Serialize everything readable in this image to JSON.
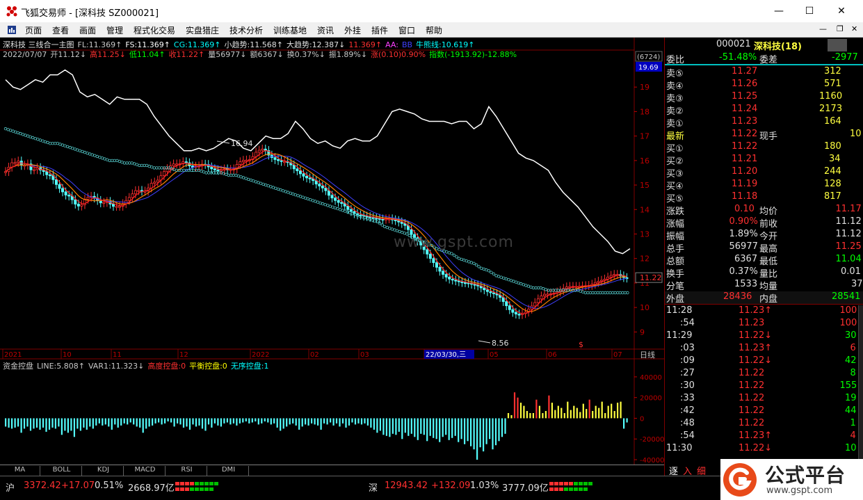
{
  "window": {
    "app_name": "飞狐交易师",
    "title": "飞狐交易师 - [深科技 SZ000021]",
    "minimize": "—",
    "maximize": "☐",
    "close": "✕"
  },
  "menu": [
    "页面",
    "查看",
    "画面",
    "管理",
    "程式化交易",
    "实盘猎庄",
    "技术分析",
    "训练基地",
    "资讯",
    "外挂",
    "插件",
    "窗口",
    "帮助"
  ],
  "mdi": [
    "—",
    "❐",
    "✕"
  ],
  "info_line1": [
    {
      "t": "深科技 三线合一主图",
      "c": "#e0e0e0"
    },
    {
      "t": "FL:11.369↑",
      "c": "#c8c8c8"
    },
    {
      "t": "FS:11.369↑",
      "c": "#ffffff"
    },
    {
      "t": "CG:11.369↑",
      "c": "#00ffff"
    },
    {
      "t": "小趋势:11.568↑",
      "c": "#e0e0e0"
    },
    {
      "t": "大趋势:12.387↓",
      "c": "#e0e0e0"
    },
    {
      "t": "11.369↑",
      "c": "#ff3030"
    },
    {
      "t": "AA:",
      "c": "#ff40ff"
    },
    {
      "t": "BB",
      "c": "#4040ff"
    },
    {
      "t": "牛熊线:10.619↑",
      "c": "#00ffff"
    }
  ],
  "info_line2": [
    {
      "t": "2022/07/07",
      "c": "#c8c8c8"
    },
    {
      "t": "开11.12↓",
      "c": "#c8c8c8"
    },
    {
      "t": "高11.25↓",
      "c": "#ff3030"
    },
    {
      "t": "低11.04↑",
      "c": "#00ff00"
    },
    {
      "t": "收11.22↑",
      "c": "#ff3030"
    },
    {
      "t": "量56977↓",
      "c": "#c8c8c8"
    },
    {
      "t": "额6367↓",
      "c": "#c8c8c8"
    },
    {
      "t": "换0.37%↓",
      "c": "#c8c8c8"
    },
    {
      "t": "振1.89%↓",
      "c": "#c8c8c8"
    },
    {
      "t": "涨(0.10)0.90%",
      "c": "#ff3030"
    },
    {
      "t": "指数(-1913.92)-12.88%",
      "c": "#00ff00"
    }
  ],
  "sub_info": [
    {
      "t": "资金控盘",
      "c": "#c8c8c8"
    },
    {
      "t": "LINE:5.808↑",
      "c": "#c8c8c8"
    },
    {
      "t": "VAR1:11.323↓",
      "c": "#c8c8c8"
    },
    {
      "t": "高度控盘:0",
      "c": "#ff3030"
    },
    {
      "t": "平衡控盘:0",
      "c": "#ffff00"
    },
    {
      "t": "无序控盘:1",
      "c": "#00ffff"
    }
  ],
  "watermark": "www.gspt.com",
  "price_axis": {
    "box_top": "(6724)",
    "box_bottom": "19.69",
    "current": "11.22"
  },
  "annotations": {
    "high": "16.94",
    "low": "8.56",
    "dollar": "$"
  },
  "date_cursor": "22/03/30,三",
  "period_label": "日线",
  "tabs": [
    "MA",
    "BOLL",
    "KDJ",
    "MACD",
    "RSI",
    "DMI"
  ],
  "chart_data": [
    {
      "type": "candlestick",
      "title": "",
      "x": [
        "2021",
        "10",
        "11",
        "12",
        "2022",
        "02",
        "03",
        "04",
        "05",
        "06",
        "07"
      ],
      "y_ticks": [
        9.0,
        10.0,
        11.0,
        12.0,
        13.0,
        14.0,
        15.0,
        16.0,
        17.0,
        18.0,
        19.0
      ],
      "ylim": [
        8.3,
        20.0
      ],
      "close": [
        15.55,
        15.73,
        15.91,
        15.92,
        15.98,
        15.8,
        15.81,
        15.86,
        15.62,
        15.63,
        15.71,
        15.61,
        15.55,
        15.42,
        15.41,
        15.22,
        15.02,
        14.86,
        14.72,
        14.59,
        14.55,
        14.4,
        14.22,
        14.14,
        14.2,
        14.42,
        14.5,
        14.54,
        14.47,
        14.37,
        14.27,
        14.29,
        14.33,
        14.22,
        14.13,
        14.13,
        14.13,
        14.24,
        14.37,
        14.49,
        14.64,
        14.77,
        14.78,
        14.75,
        14.75,
        14.88,
        15.07,
        15.12,
        15.2,
        15.38,
        15.55,
        15.67,
        15.78,
        15.86,
        15.86,
        15.87,
        15.95,
        15.91,
        15.78,
        15.72,
        15.77,
        15.78,
        15.85,
        15.84,
        15.74,
        15.66,
        15.62,
        15.6,
        15.61,
        15.66,
        15.64,
        15.64,
        15.66,
        15.84,
        15.95,
        16.01,
        16.02,
        16.04,
        16.16,
        16.34,
        16.42,
        16.47,
        16.41,
        16.22,
        16.12,
        16.04,
        16.0,
        15.96,
        15.96,
        15.92,
        15.82,
        15.66,
        15.58,
        15.46,
        15.36,
        15.29,
        15.26,
        15.18,
        15.04,
        14.96,
        14.88,
        14.77,
        14.58,
        14.47,
        14.37,
        14.29,
        14.26,
        14.14,
        14.0,
        13.92,
        13.83,
        13.78,
        13.77,
        13.73,
        13.71,
        13.68,
        13.65,
        13.64,
        13.61,
        13.6,
        13.62,
        13.62,
        13.58,
        13.55,
        13.49,
        13.43,
        13.35,
        13.18,
        12.98,
        12.85,
        12.71,
        12.55,
        12.36,
        12.18,
        12.0,
        11.83,
        11.64,
        11.48,
        11.35,
        11.24,
        11.16,
        11.12,
        11.09,
        11.05,
        11.02,
        11.01,
        10.99,
        10.95,
        10.92,
        10.88,
        10.8,
        10.72,
        10.65,
        10.6,
        10.56,
        10.51,
        10.41,
        10.24,
        10.07,
        9.91,
        9.8,
        9.73,
        9.71,
        9.75,
        9.81,
        9.93,
        10.06,
        10.2,
        10.35,
        10.47,
        10.54,
        10.55,
        10.56,
        10.59,
        10.63,
        10.69,
        10.78,
        10.84,
        10.86,
        10.86,
        10.86,
        10.86,
        10.88,
        10.89,
        10.9,
        10.95,
        11.02,
        11.07,
        11.11,
        11.16,
        11.24,
        11.31,
        11.35,
        11.35,
        11.29,
        11.22,
        11.2
      ],
      "series": [
        {
          "values": [
            19.3,
            19.0,
            18.9,
            19.1,
            19.3,
            19.2,
            19.5,
            19.5,
            19.7,
            19.5,
            18.8,
            18.6,
            18.7,
            18.5,
            18.3,
            18.6,
            18.5,
            18.5,
            18.5,
            18.3,
            17.8,
            17.4,
            17.0,
            16.7,
            16.4,
            16.4,
            16.5,
            16.4,
            16.5,
            16.7,
            16.9,
            16.8,
            16.5,
            16.4,
            16.7,
            17.0,
            16.9,
            16.9,
            17.1,
            17.6,
            17.3,
            16.9,
            16.7,
            16.8,
            16.6,
            16.5,
            16.8,
            16.9,
            16.8,
            16.8,
            17.0,
            17.5,
            18.0,
            18.1,
            18.0,
            17.9,
            17.7,
            17.6,
            17.6,
            17.6,
            17.5,
            17.6,
            17.6,
            17.3,
            17.5,
            18.2,
            17.8,
            17.3,
            16.8,
            16.3,
            16.1,
            16.0,
            15.8,
            15.6,
            15.1,
            14.7,
            14.4,
            14.1,
            13.7,
            13.3,
            13.0,
            12.7,
            12.3,
            12.2,
            12.4
          ]
        },
        {
          "values": [
            17.3,
            17.2,
            17.1,
            17.0,
            16.9,
            16.8,
            16.7,
            16.7,
            16.6,
            16.5,
            16.4,
            16.3,
            16.2,
            16.1,
            16.0,
            16.0,
            15.9,
            15.9,
            15.8,
            15.8,
            15.7,
            15.7,
            15.7,
            15.6,
            15.6,
            15.6,
            15.6,
            15.5,
            15.5,
            15.5,
            15.4,
            15.4,
            15.3,
            15.2,
            15.1,
            15.0,
            14.9,
            14.8,
            14.7,
            14.6,
            14.5,
            14.4,
            14.3,
            14.2,
            14.1,
            14.0,
            13.9,
            13.8,
            13.7,
            13.6,
            13.5,
            13.3,
            13.2,
            13.1,
            13.0,
            12.8,
            12.7,
            12.6,
            12.4,
            12.3,
            12.2,
            12.0,
            11.9,
            11.8,
            11.6,
            11.5,
            11.3,
            11.2,
            11.1,
            11.0,
            10.9,
            10.8,
            10.8,
            10.7,
            10.7,
            10.7,
            10.7,
            10.7,
            10.6,
            10.6,
            10.6,
            10.6,
            10.6,
            10.6,
            10.6
          ]
        }
      ]
    },
    {
      "type": "bar",
      "title": "",
      "y_ticks": [
        -40000,
        -20000,
        0,
        20000,
        40000
      ],
      "ylim": [
        -42000,
        48000
      ],
      "values": [
        -8000,
        -9000,
        -10000,
        -9000,
        -8000,
        -14000,
        -10000,
        -8000,
        -12000,
        -10000,
        -9000,
        -11000,
        -9000,
        -13000,
        -11000,
        -9000,
        -10000,
        -8000,
        -16000,
        -12000,
        -14000,
        -12000,
        -18000,
        -10000,
        -12000,
        -9000,
        -11000,
        -8000,
        -10000,
        -7000,
        -5000,
        -7000,
        -6000,
        -8000,
        -11000,
        -6000,
        -9000,
        -7000,
        -5000,
        -6000,
        -4000,
        -6000,
        -8000,
        -9000,
        -14000,
        -10000,
        -8000,
        -7000,
        -5000,
        -4000,
        -6000,
        -5000,
        -3000,
        -4000,
        -8000,
        -5000,
        -6000,
        -9000,
        -8000,
        -11000,
        -6000,
        -8000,
        -7000,
        -10000,
        -12000,
        -6000,
        -9000,
        -5000,
        -7000,
        -8000,
        -5000,
        -4000,
        -6000,
        -5000,
        -7000,
        -5000,
        -4000,
        -3000,
        -5000,
        -4000,
        -3000,
        -6000,
        -5000,
        -3000,
        -4000,
        -6000,
        -5000,
        -9000,
        -12000,
        -10000,
        -8000,
        -6000,
        -5000,
        -7000,
        -11000,
        -8000,
        -6000,
        -7000,
        -5000,
        -6000,
        -7000,
        -11000,
        -5000,
        -6000,
        -4000,
        -7000,
        -5000,
        -8000,
        -5000,
        -9000,
        -7000,
        -4000,
        -6000,
        -5000,
        -6000,
        -5000,
        -7000,
        -9000,
        -11000,
        -14000,
        -12000,
        -16000,
        -17000,
        -18000,
        -15000,
        -16000,
        -13000,
        -20000,
        -14000,
        -17000,
        -15000,
        -18000,
        -21000,
        -15000,
        -16000,
        -22000,
        -17000,
        -19000,
        -20000,
        -23000,
        -18000,
        -16000,
        -21000,
        -19000,
        -17000,
        -23000,
        -20000,
        -25000,
        -22000,
        -27000,
        -30000,
        -40000,
        -28000,
        -32000,
        -25000,
        -20000,
        -30000,
        -26000,
        -22000,
        -18000,
        -15000,
        5000,
        3000,
        25000,
        20000,
        15000,
        12000,
        7000,
        5000,
        5000,
        18000,
        12000,
        5000,
        7000,
        22000,
        15000,
        8000,
        12000,
        10000,
        5000,
        16000,
        8000,
        12000,
        10000,
        6000,
        14000,
        9000,
        18000,
        7000,
        12000,
        10000,
        16000,
        5000,
        12000,
        14000,
        7000,
        15000,
        16000,
        -10000,
        -4000
      ]
    }
  ],
  "quote": {
    "code": "000021",
    "name": "深科技(18)",
    "weibi_label": "委比",
    "weibi_value": "-51.48%",
    "weicha_label": "委差",
    "weicha_value": "-2977",
    "sell": [
      {
        "label": "卖⑤",
        "price": "11.27",
        "vol": "312"
      },
      {
        "label": "卖④",
        "price": "11.26",
        "vol": "571"
      },
      {
        "label": "卖③",
        "price": "11.25",
        "vol": "1160"
      },
      {
        "label": "卖②",
        "price": "11.24",
        "vol": "2173"
      },
      {
        "label": "卖①",
        "price": "11.23",
        "vol": "164"
      }
    ],
    "latest_label": "最新",
    "latest_value": "11.22",
    "xianshou_label": "现手",
    "xianshou_value": "10",
    "buy": [
      {
        "label": "买①",
        "price": "11.22",
        "vol": "180"
      },
      {
        "label": "买②",
        "price": "11.21",
        "vol": "34"
      },
      {
        "label": "买③",
        "price": "11.20",
        "vol": "244"
      },
      {
        "label": "买④",
        "price": "11.19",
        "vol": "128"
      },
      {
        "label": "买⑤",
        "price": "11.18",
        "vol": "817"
      }
    ],
    "stats": [
      {
        "l1": "涨跌",
        "v1": "0.10",
        "c1": "#ff3030",
        "l2": "均价",
        "v2": "11.17",
        "c2": "#ff3030"
      },
      {
        "l1": "涨幅",
        "v1": "0.90%",
        "c1": "#ff3030",
        "l2": "前收",
        "v2": "11.12",
        "c2": "#e0e0e0"
      },
      {
        "l1": "振幅",
        "v1": "1.89%",
        "c1": "#e0e0e0",
        "l2": "今开",
        "v2": "11.12",
        "c2": "#e0e0e0"
      },
      {
        "l1": "总手",
        "v1": "56977",
        "c1": "#e0e0e0",
        "l2": "最高",
        "v2": "11.25",
        "c2": "#ff3030"
      },
      {
        "l1": "总额",
        "v1": "6367",
        "c1": "#e0e0e0",
        "l2": "最低",
        "v2": "11.04",
        "c2": "#00ff00"
      },
      {
        "l1": "换手",
        "v1": "0.37%",
        "c1": "#e0e0e0",
        "l2": "量比",
        "v2": "0.01",
        "c2": "#e0e0e0"
      },
      {
        "l1": "分笔",
        "v1": "1533",
        "c1": "#e0e0e0",
        "l2": "均量",
        "v2": "37",
        "c2": "#e0e0e0"
      }
    ],
    "waipan_label": "外盘",
    "waipan_value": "28436",
    "neipan_label": "内盘",
    "neipan_value": "28541",
    "ticks": [
      {
        "time": "11:28",
        "price": "11.23↑",
        "vol": "100",
        "pc": "#ff3030",
        "vc": "#ff3030"
      },
      {
        "time": ":54",
        "price": "11.23",
        "vol": "100",
        "pc": "#ff3030",
        "vc": "#ff3030"
      },
      {
        "time": "11:29",
        "price": "11.22↓",
        "vol": "30",
        "pc": "#ff3030",
        "vc": "#00ff00"
      },
      {
        "time": ":03",
        "price": "11.23↑",
        "vol": "6",
        "pc": "#ff3030",
        "vc": "#ff3030"
      },
      {
        "time": ":09",
        "price": "11.22↓",
        "vol": "42",
        "pc": "#ff3030",
        "vc": "#00ff00"
      },
      {
        "time": ":27",
        "price": "11.22",
        "vol": "8",
        "pc": "#ff3030",
        "vc": "#00ff00"
      },
      {
        "time": ":30",
        "price": "11.22",
        "vol": "155",
        "pc": "#ff3030",
        "vc": "#00ff00"
      },
      {
        "time": ":33",
        "price": "11.22",
        "vol": "19",
        "pc": "#ff3030",
        "vc": "#00ff00"
      },
      {
        "time": ":42",
        "price": "11.22",
        "vol": "44",
        "pc": "#ff3030",
        "vc": "#00ff00"
      },
      {
        "time": ":48",
        "price": "11.22",
        "vol": "1",
        "pc": "#ff3030",
        "vc": "#00ff00"
      },
      {
        "time": ":54",
        "price": "11.23↑",
        "vol": "4",
        "pc": "#ff3030",
        "vc": "#ff3030"
      },
      {
        "time": "11:30",
        "price": "11.22↓",
        "vol": "10",
        "pc": "#ff3030",
        "vc": "#00ff00"
      }
    ],
    "bottom_tabs": [
      "逐",
      "入",
      "细"
    ]
  },
  "status": {
    "sh_label": "沪",
    "sh_index": "3372.42",
    "sh_change": "+17.07",
    "sh_pct": "0.51%",
    "sh_amount": "2668.97亿",
    "sz_label": "深",
    "sz_index": "12943.42",
    "sz_change": "+132.09",
    "sz_pct": "1.03%",
    "sz_amount": "3777.09亿"
  },
  "brand": {
    "name": "公式平台",
    "url": "www.gspt.com"
  },
  "colors": {
    "up": "#ff3030",
    "down": "#54ffff",
    "flat": "#ffff00",
    "bg": "#000000",
    "grid": "#800000",
    "text": "#c8c8c8",
    "accent": "#ffff00"
  }
}
